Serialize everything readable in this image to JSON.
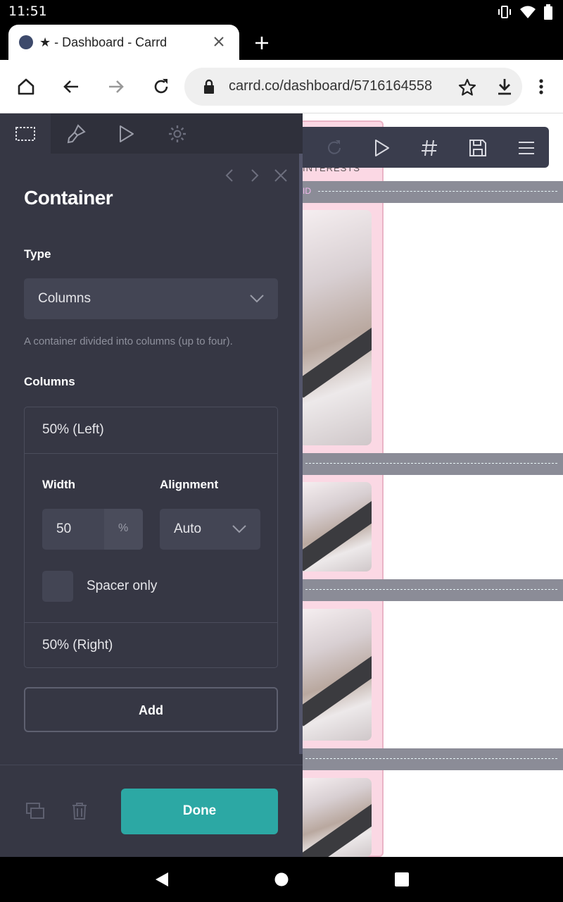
{
  "status_bar": {
    "time": "11:51"
  },
  "browser": {
    "tab_title": "★ - Dashboard - Carrd",
    "url": "carrd.co/dashboard/5716164558"
  },
  "canvas": {
    "interests_label": "INTERESTS",
    "section_tag": "ID"
  },
  "panel": {
    "title": "Container",
    "type_label": "Type",
    "type_value": "Columns",
    "type_hint": "A container divided into columns (up to four).",
    "columns_label": "Columns",
    "columns": [
      {
        "label": "50% (Left)"
      },
      {
        "label": "50% (Right)"
      }
    ],
    "width_label": "Width",
    "width_value": "50",
    "width_unit": "%",
    "alignment_label": "Alignment",
    "alignment_value": "Auto",
    "spacer_label": "Spacer only",
    "add_label": "Add",
    "done_label": "Done"
  },
  "colors": {
    "panel_bg": "#363744",
    "accent": "#2ca8a4"
  }
}
